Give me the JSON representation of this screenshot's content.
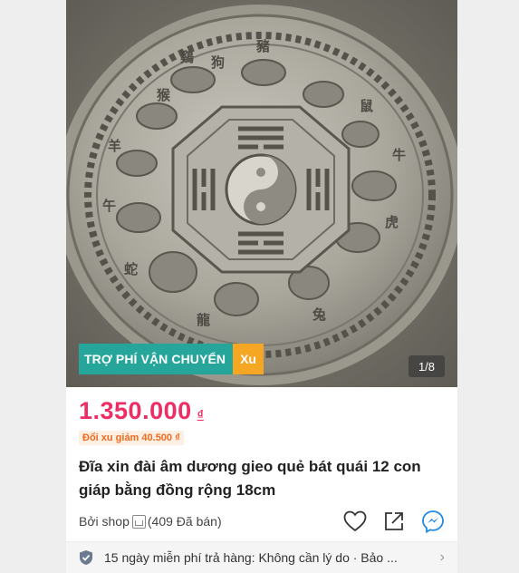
{
  "gallery": {
    "promo_label": "TRỢ PHÍ VẬN CHUYỂN",
    "promo_coin": "Xu",
    "image_counter": "1/8",
    "plate_characters": [
      "狗",
      "鷄",
      "猴",
      "羊",
      "午",
      "蛇",
      "龍",
      "兔",
      "虎",
      "牛",
      "鼠",
      "豬"
    ]
  },
  "product": {
    "price": "1.350.000",
    "currency": "₫",
    "coin_discount": "Đổi xu giảm 40.500 ₫",
    "title": "Đĩa xin đài âm dương gieo quẻ bát quái 12 con giáp bằng đồng rộng 18cm",
    "seller_prefix": "Bởi shop",
    "sold_count": "(409 Đã bán)"
  },
  "returns": {
    "text": "15 ngày miễn phí trả hàng: Không cần lý do · Bảo ...",
    "chevron": "›"
  },
  "colors": {
    "price": "#ee2d64",
    "promo_teal": "#26a69a",
    "promo_coin": "#f5a623",
    "messenger": "#1e88e5"
  },
  "icons": [
    "heart-icon",
    "share-icon",
    "messenger-icon",
    "shield-icon",
    "shop-icon",
    "chevron-right-icon"
  ]
}
